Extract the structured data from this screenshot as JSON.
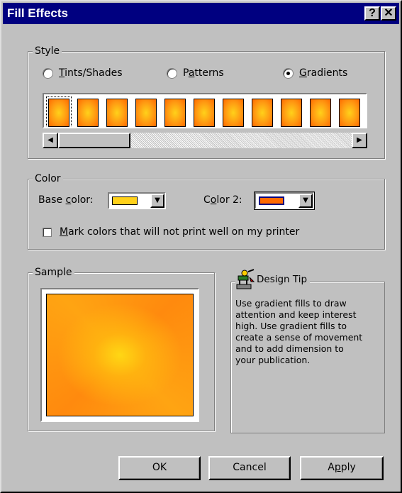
{
  "window": {
    "title": "Fill Effects",
    "help_button": "?",
    "close_button": "✕"
  },
  "style": {
    "group_label": "Style",
    "options": [
      {
        "label": "Tints/Shades",
        "mnemonic": "T",
        "checked": false
      },
      {
        "label": "Patterns",
        "mnemonic": "a",
        "checked": false
      },
      {
        "label": "Gradients",
        "mnemonic": "G",
        "checked": true
      }
    ],
    "swatch_count": 11,
    "selected_swatch": 0
  },
  "color": {
    "group_label": "Color",
    "base_color_label": "Base color:",
    "base_color_mnemonic": "c",
    "base_color_value": "#ffd11a",
    "color2_label": "Color 2:",
    "color2_mnemonic": "o",
    "color2_value": "#ff6a00",
    "mark_colors_label": "Mark colors that will not print well on my printer",
    "mark_colors_checked": false
  },
  "sample": {
    "group_label": "Sample"
  },
  "design_tip": {
    "heading": "Design Tip",
    "text": "Use gradient fills to draw\nattention and keep interest\nhigh.  Use gradient fills to\ncreate a sense of movement\nand to add dimension to\nyour publication."
  },
  "buttons": {
    "ok": "OK",
    "cancel": "Cancel",
    "apply": "Apply"
  },
  "icons": [
    "help-icon",
    "close-icon",
    "scroll-left-icon",
    "scroll-right-icon",
    "dropdown-arrow-icon",
    "design-tip-icon"
  ]
}
